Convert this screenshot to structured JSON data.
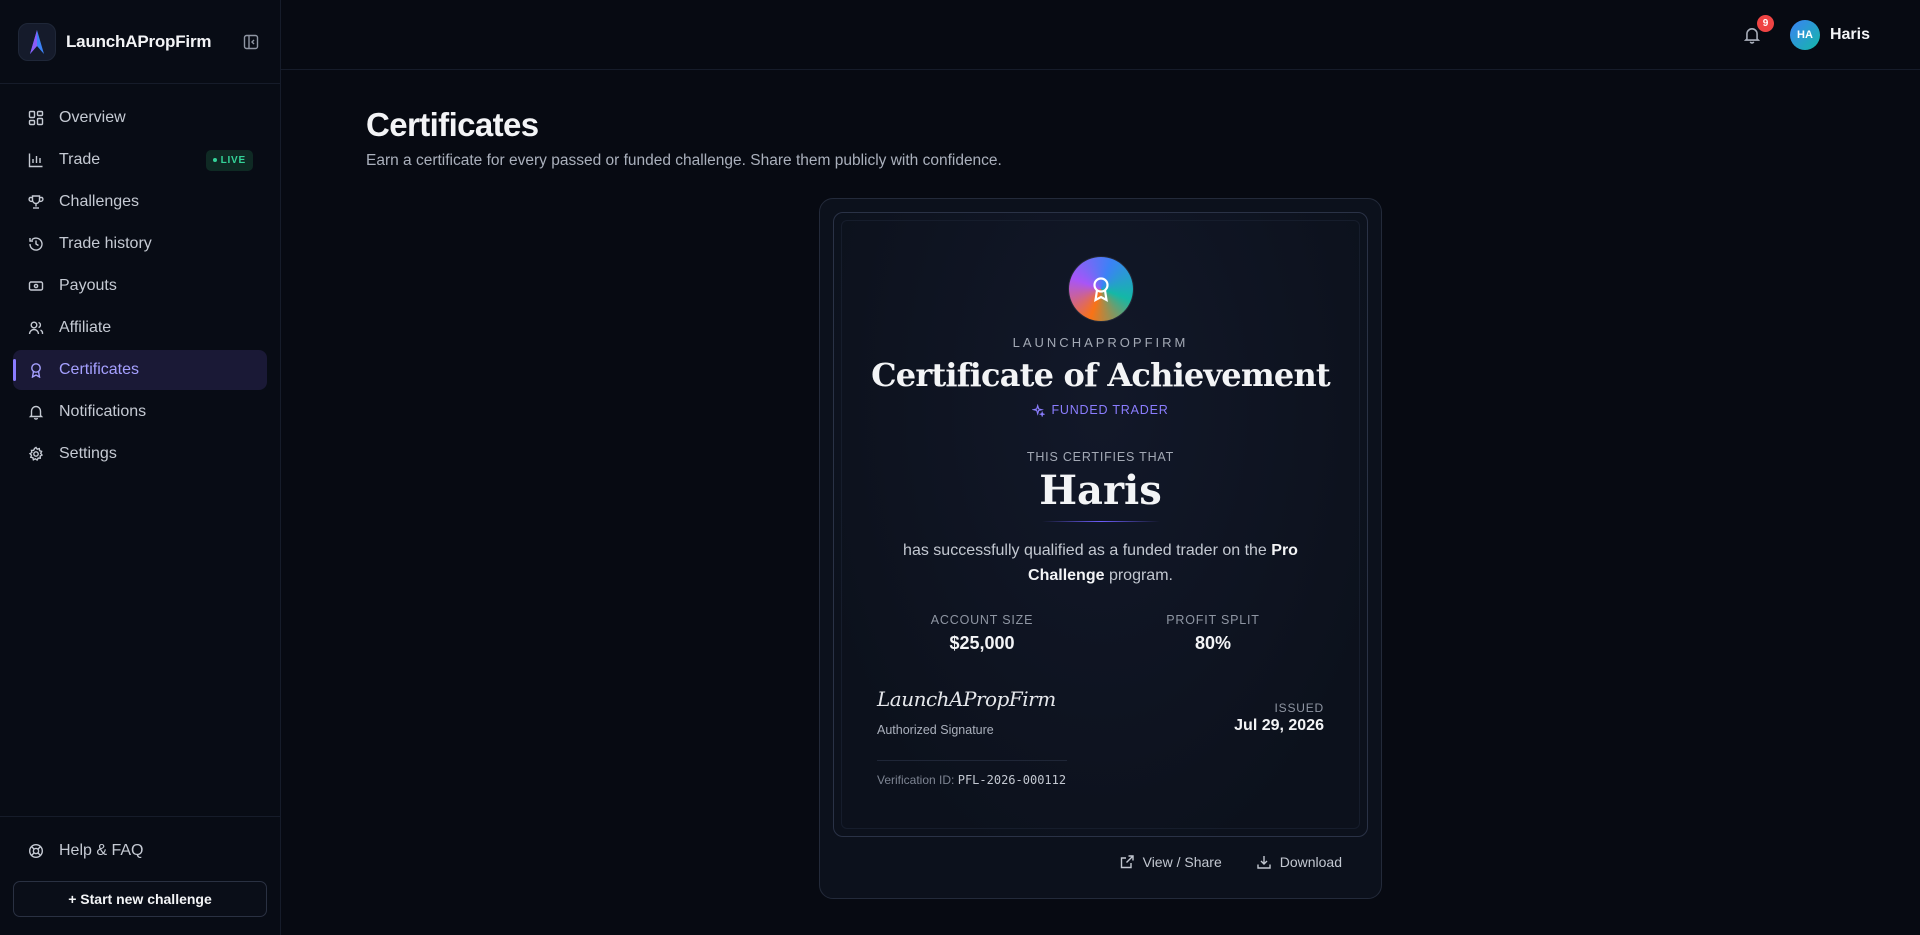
{
  "app": {
    "name": "LaunchAPropFirm"
  },
  "sidebar": {
    "items": [
      {
        "label": "Overview",
        "icon": "grid-icon"
      },
      {
        "label": "Trade",
        "icon": "chart-icon",
        "badge": "LIVE"
      },
      {
        "label": "Challenges",
        "icon": "trophy-icon"
      },
      {
        "label": "Trade history",
        "icon": "history-icon"
      },
      {
        "label": "Payouts",
        "icon": "banknote-icon"
      },
      {
        "label": "Affiliate",
        "icon": "users-icon"
      },
      {
        "label": "Certificates",
        "icon": "award-icon",
        "active": true
      },
      {
        "label": "Notifications",
        "icon": "bell-icon"
      },
      {
        "label": "Settings",
        "icon": "gear-icon"
      }
    ],
    "help": "Help & FAQ",
    "start_challenge": "+ Start new challenge"
  },
  "header": {
    "notification_count": "9",
    "avatar_initials": "HA",
    "user_name": "Haris"
  },
  "page": {
    "title": "Certificates",
    "subtitle": "Earn a certificate for every passed or funded challenge. Share them publicly with confidence."
  },
  "certificate": {
    "brand": "LAUNCHAPROPFIRM",
    "title": "Certificate of Achievement",
    "tier": "FUNDED TRADER",
    "certifies": "THIS CERTIFIES THAT",
    "recipient": "Haris",
    "statement_pre": "has successfully qualified as a funded trader on the ",
    "program": "Pro Challenge",
    "statement_post": " program.",
    "account_size_label": "ACCOUNT SIZE",
    "account_size": "$25,000",
    "profit_split_label": "PROFIT SPLIT",
    "profit_split": "80%",
    "signature": "LaunchAPropFirm",
    "signature_label": "Authorized Signature",
    "issued_label": "ISSUED",
    "issued_date": "Jul 29, 2026",
    "verification_label": "Verification ID:",
    "verification_id": "PFL-2026-000112"
  },
  "actions": {
    "view_share": "View / Share",
    "download": "Download"
  },
  "colors": {
    "accent": "#8b7dff",
    "live": "#34d399",
    "badge": "#ef4444",
    "background": "#070a12"
  }
}
